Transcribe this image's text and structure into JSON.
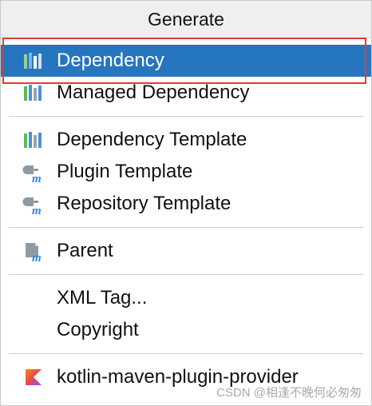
{
  "popup": {
    "title": "Generate",
    "groups": [
      {
        "items": [
          {
            "label": "Dependency",
            "icon": "maven-bars-icon",
            "selected": true
          },
          {
            "label": "Managed Dependency",
            "icon": "maven-bars-icon",
            "selected": false
          }
        ]
      },
      {
        "items": [
          {
            "label": "Dependency Template",
            "icon": "maven-bars-icon"
          },
          {
            "label": "Plugin Template",
            "icon": "maven-plugin-icon"
          },
          {
            "label": "Repository Template",
            "icon": "maven-plugin-icon"
          }
        ]
      },
      {
        "items": [
          {
            "label": "Parent",
            "icon": "maven-parent-icon"
          }
        ]
      },
      {
        "items": [
          {
            "label": "XML Tag...",
            "icon": ""
          },
          {
            "label": "Copyright",
            "icon": ""
          }
        ]
      },
      {
        "items": [
          {
            "label": "kotlin-maven-plugin-provider",
            "icon": "kotlin-icon"
          }
        ]
      }
    ]
  },
  "watermark": "CSDN @相逢不晚何必匆匆",
  "colors": {
    "selection": "#2675bf",
    "highlight_box": "#e53935",
    "header_bg": "#efefef",
    "bar_green": "#5cb85c",
    "bar_blue": "#4a90d9",
    "bar_grey": "#9aa5ad"
  }
}
